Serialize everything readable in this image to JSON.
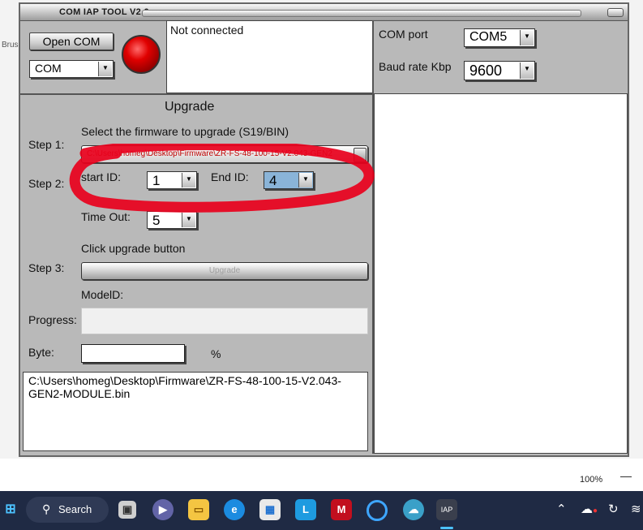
{
  "background": {
    "partial_text": "Brus",
    "zoom_level": "100%"
  },
  "window": {
    "title": "COM IAP  TOOL V2.6",
    "open_com_label": "Open COM",
    "com_select_value": "COM",
    "status_text": "Not connected",
    "com_port_label": "COM port",
    "com_port_value": "COM5",
    "baud_rate_label": "Baud rate Kbp",
    "baud_rate_value": "9600",
    "upgrade_heading": "Upgrade",
    "step1_label": "Step 1:",
    "step1_instruction": "Select the firmware  to upgrade (S19/BIN)",
    "file_path": "C:\\Users\\homeg\\Desktop\\Firmware\\ZR-FS-48-100-15-V2.043-GEN2",
    "step2_label": "Step 2:",
    "start_id_label": "start ID:",
    "start_id_value": "1",
    "end_id_label": "End ID:",
    "end_id_value": "4",
    "timeout_label": "Time Out:",
    "timeout_value": "5",
    "step3_instruction": "Click upgrade button",
    "step3_label": "Step 3:",
    "upgrade_button_label": "Upgrade",
    "model_id_label": "ModelD:",
    "progress_label": "Progress:",
    "byte_label": "Byte:",
    "byte_value": "",
    "percent_sign": "%",
    "log_text": "C:\\Users\\homeg\\Desktop\\Firmware\\ZR-FS-48-100-15-V2.043-GEN2-MODULE.bin"
  },
  "taskbar": {
    "search_label": "Search",
    "app_icons": [
      "windows-start-icon",
      "task-view-icon",
      "teams-icon",
      "file-explorer-icon",
      "edge-icon",
      "store-icon",
      "l-app-icon",
      "mcafee-icon",
      "cortana-icon",
      "weather-icon",
      "com-iap-tool-icon"
    ],
    "tray_icons": [
      "chevron-up-icon",
      "network-alert-icon",
      "refresh-icon",
      "wifi-icon"
    ],
    "active_app_label": "IAP"
  },
  "colors": {
    "annotation_red": "#e8001c",
    "led_red": "#e00000",
    "file_path_text": "#c00000",
    "taskbar_bg": "#1f2a44"
  }
}
